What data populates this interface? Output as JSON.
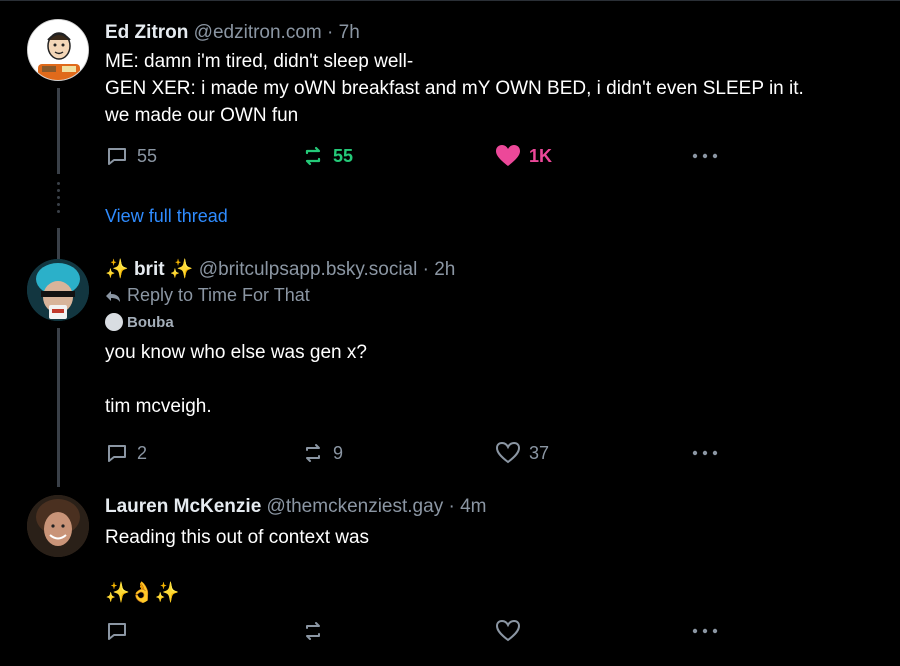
{
  "posts": [
    {
      "name": "Ed Zitron",
      "handle": "@edzitron.com",
      "separator": "·",
      "time": "7h",
      "lines": [
        "ME: damn i'm tired, didn't sleep well-",
        "GEN XER: i made my oWN breakfast and mY OWN BED, i didn't even SLEEP in it.",
        "we made our OWN fun"
      ],
      "replies": "55",
      "reposts": "55",
      "likes": "1K",
      "view_thread": "View full thread"
    },
    {
      "name_prefix": "✨",
      "name": "brit",
      "name_suffix": "✨",
      "handle": "@britculpsapp.bsky.social",
      "separator": "·",
      "time": "2h",
      "reply_to": "Reply to Time For That",
      "quote_author": "Bouba",
      "lines": [
        "you know who else was gen x?",
        "",
        "tim mcveigh."
      ],
      "replies": "2",
      "reposts": "9",
      "likes": "37"
    },
    {
      "name": "Lauren McKenzie",
      "handle": "@themckenziest.gay",
      "separator": "·",
      "time": "4m",
      "lines": [
        "Reading this out of context was",
        "",
        "✨👌✨"
      ]
    }
  ],
  "colors": {
    "background": "#000000",
    "muted": "#8b96a3",
    "link": "#2f8cff",
    "repost_active": "#24c978",
    "like_active": "#ec4899"
  }
}
